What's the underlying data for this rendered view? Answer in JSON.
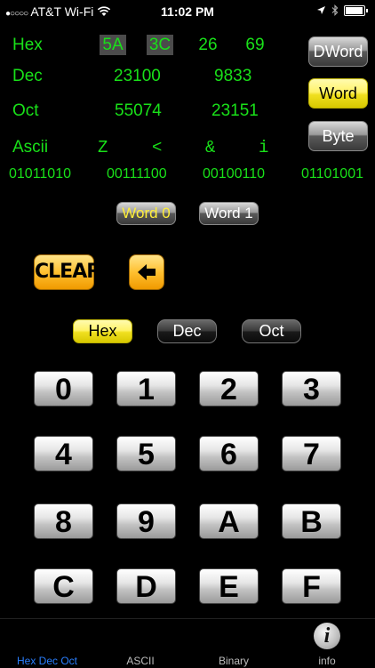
{
  "status_bar": {
    "signal_dots": "●○○○○",
    "carrier": "AT&T Wi-Fi",
    "time": "11:02 PM",
    "icons": [
      "wifi-icon",
      "location-icon",
      "bluetooth-icon",
      "battery-icon"
    ]
  },
  "display": {
    "rows": [
      {
        "label": "Hex",
        "values": [
          "5A",
          "3C",
          "26",
          "69"
        ]
      },
      {
        "label": "Dec",
        "values": [
          "23100",
          "9833"
        ]
      },
      {
        "label": "Oct",
        "values": [
          "55074",
          "23151"
        ]
      },
      {
        "label": "Ascii",
        "values": [
          "Z",
          "<",
          "&",
          "i"
        ]
      }
    ],
    "binary": [
      "01011010",
      "00111100",
      "00100110",
      "01101001"
    ]
  },
  "size_buttons": [
    {
      "label": "DWord",
      "selected": false
    },
    {
      "label": "Word",
      "selected": true
    },
    {
      "label": "Byte",
      "selected": false
    }
  ],
  "word_selector": [
    {
      "label": "Word 0",
      "selected": true
    },
    {
      "label": "Word 1",
      "selected": false
    }
  ],
  "actions": {
    "clear_label": "CLEAR",
    "backspace_icon": "backspace-arrow-icon"
  },
  "modes": [
    {
      "label": "Hex",
      "selected": true
    },
    {
      "label": "Dec",
      "selected": false
    },
    {
      "label": "Oct",
      "selected": false
    }
  ],
  "keypad": [
    "0",
    "1",
    "2",
    "3",
    "4",
    "5",
    "6",
    "7",
    "8",
    "9",
    "A",
    "B",
    "C",
    "D",
    "E",
    "F"
  ],
  "tabs": [
    {
      "label": "Hex Dec Oct",
      "active": true
    },
    {
      "label": "ASCII",
      "active": false
    },
    {
      "label": "Binary",
      "active": false
    },
    {
      "label": "info",
      "active": false
    }
  ],
  "colors": {
    "display_green": "#19e019",
    "active_tab": "#2a7fff",
    "selected_yellow": "#fff36a"
  }
}
